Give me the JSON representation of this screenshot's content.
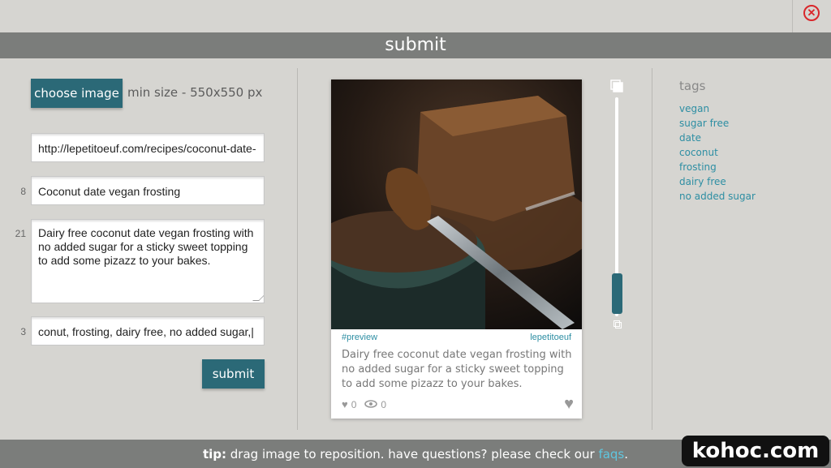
{
  "close_icon": "close-circle-icon",
  "header": {
    "title": "submit"
  },
  "form": {
    "choose_image_label": "choose image",
    "min_size_text": "min size - 550x550 px",
    "url_value": "http://lepetitoeuf.com/recipes/coconut-date-",
    "title_count": "8",
    "title_value": "Coconut date vegan frosting",
    "desc_count": "21",
    "desc_value": "Dairy free coconut date vegan frosting with no added sugar for a sticky sweet topping to add some pizazz to your bakes.",
    "tags_count": "3",
    "tags_value": "conut, frosting, dairy free, no added sugar,|",
    "submit_label": "submit"
  },
  "preview": {
    "tag": "#preview",
    "author": "lepetitoeuf",
    "description": "Dairy free coconut date vegan frosting with no added sugar for a sticky sweet topping to add some pizazz to your bakes.",
    "likes": "0",
    "views": "0"
  },
  "slider": {
    "level_percent": 15
  },
  "tags": {
    "heading": "tags",
    "items": [
      "vegan",
      "sugar free",
      "date",
      "coconut",
      "frosting",
      "dairy free",
      "no added sugar"
    ]
  },
  "footer": {
    "tip_label": "tip:",
    "tip_text": " drag image to reposition. have questions? please check our ",
    "faq_link": "faqs",
    "tail": "."
  },
  "watermark": "kohoc.com",
  "colors": {
    "accent": "#2b6977",
    "link": "#2d8ea3",
    "close": "#d9262a",
    "bar": "#7b7d7b"
  }
}
